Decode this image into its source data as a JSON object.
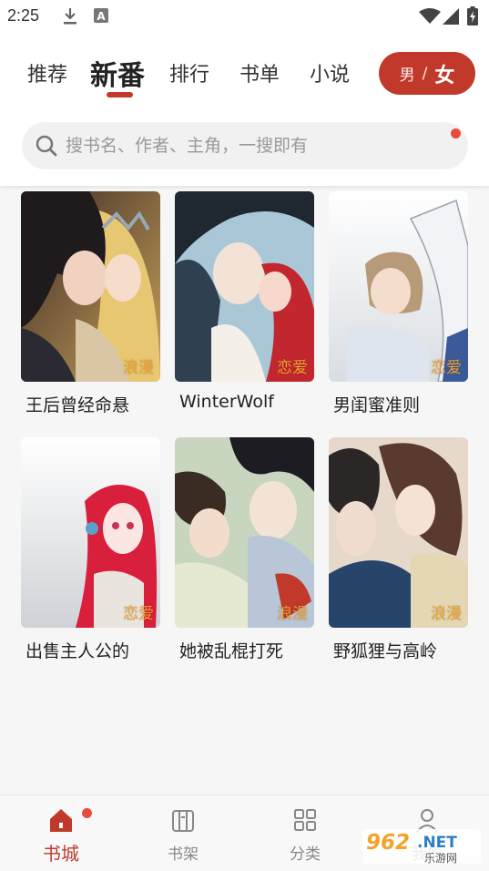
{
  "status_bar": {
    "time": "2:25",
    "icons": [
      "download-icon",
      "a-notification-icon",
      "wifi-icon",
      "signal-icon",
      "battery-icon"
    ]
  },
  "tabs": [
    {
      "label": "推荐",
      "active": false
    },
    {
      "label": "新番",
      "active": true
    },
    {
      "label": "排行",
      "active": false
    },
    {
      "label": "书单",
      "active": false
    },
    {
      "label": "小说",
      "active": false
    }
  ],
  "gender_toggle": {
    "male": "男",
    "separator": "/",
    "female": "女",
    "selected": "女"
  },
  "search": {
    "placeholder": "搜书名、作者、主角，一搜即有"
  },
  "books": [
    {
      "title": "王后曾经命悬",
      "tag": "浪漫"
    },
    {
      "title": "WinterWolf",
      "tag": "恋爱"
    },
    {
      "title": "男闺蜜准则",
      "tag": "恋爱"
    },
    {
      "title": "出售主人公的",
      "tag": "恋爱"
    },
    {
      "title": "她被乱棍打死",
      "tag": "浪漫"
    },
    {
      "title": "野狐狸与高岭",
      "tag": "浪漫"
    }
  ],
  "bottom_nav": [
    {
      "label": "书城",
      "icon": "home-icon",
      "active": true
    },
    {
      "label": "书架",
      "icon": "bookshelf-icon",
      "active": false
    },
    {
      "label": "分类",
      "icon": "category-grid-icon",
      "active": false
    },
    {
      "label": "我的",
      "icon": "profile-icon",
      "active": false
    }
  ],
  "watermark": {
    "brand": "962.NET",
    "subtitle": "乐游网"
  },
  "colors": {
    "accent": "#c0392b",
    "tag": "#f0a030",
    "badge": "#e74c3c"
  }
}
